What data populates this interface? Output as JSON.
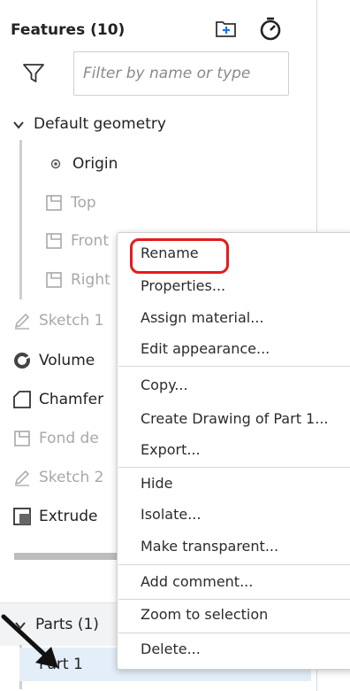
{
  "header": {
    "title": "Features (10)",
    "add_folder_icon": "add-folder-icon",
    "rollback_icon": "stopwatch-icon"
  },
  "filter": {
    "placeholder": "Filter by name or type",
    "icon": "funnel-icon"
  },
  "tree": {
    "default_geometry_label": "Default geometry",
    "origin_label": "Origin",
    "top_label": "Top",
    "front_label": "Front",
    "right_label": "Right",
    "sketch1_label": "Sketch 1",
    "volume_label": "Volume",
    "chamfer_label": "Chamfer",
    "fond_label": "Fond de",
    "sketch2_label": "Sketch 2",
    "extrude_label": "Extrude"
  },
  "parts": {
    "header_label": "Parts (1)",
    "items": [
      "Part 1"
    ]
  },
  "context_menu": {
    "items": [
      "Rename",
      "Properties...",
      "Assign material...",
      "Edit appearance...",
      "Copy...",
      "Create Drawing of Part 1...",
      "Export...",
      "Hide",
      "Isolate...",
      "Make transparent...",
      "Add comment...",
      "Zoom to selection",
      "Delete..."
    ]
  },
  "colors": {
    "highlight": "#e51b1b",
    "selected_row": "#e3eef8",
    "muted_text": "#a8a8a8"
  }
}
